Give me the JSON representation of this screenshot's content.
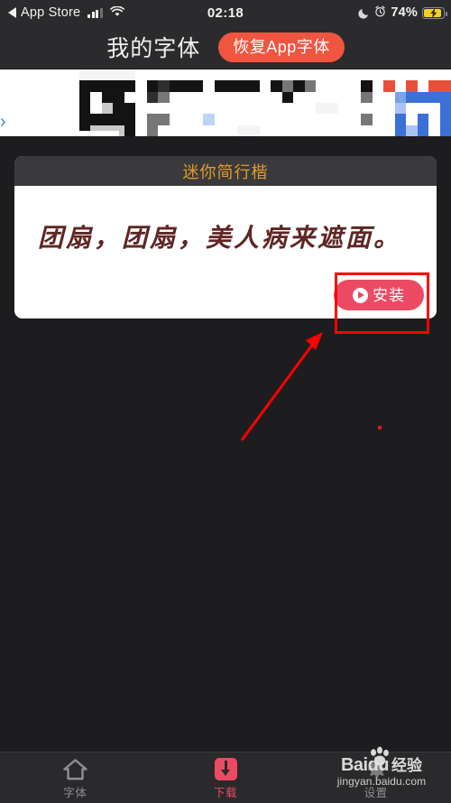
{
  "statusbar": {
    "back_label": "App Store",
    "back_icon": "back-caret-icon",
    "signal_icon": "cellular-signal-icon",
    "wifi_icon": "wifi-icon",
    "time": "02:18",
    "moon_icon": "moon-do-not-disturb-icon",
    "alarm_icon": "alarm-clock-icon",
    "battery_percent": "74%",
    "battery_icon": "battery-charging-icon",
    "battery_fill_color": "#f5d020"
  },
  "navbar": {
    "title": "我的字体",
    "restore_button": "恢复App字体",
    "restore_button_color": "#f05540"
  },
  "banner": {
    "name": "pixelated-ad-banner",
    "chevron": "›",
    "chevron_color": "#3f7fd0",
    "accent_red": "#e8503a",
    "accent_blue": "#3b70d6"
  },
  "card": {
    "title": "迷你简行楷",
    "title_color": "#e39b2a",
    "header_bg": "#3a3a3c",
    "preview_text": "团扇，团扇，美人病来遮面。",
    "preview_color": "#5e2624",
    "install_button": "安装",
    "install_icon": "play-circle-icon",
    "install_color": "#ec4a63"
  },
  "annotations": {
    "highlight_box": "install-button-highlight",
    "arrow": "pointer-arrow",
    "color": "#ff0000"
  },
  "tabbar": {
    "items": [
      {
        "label": "字体",
        "icon": "home-icon",
        "active": false
      },
      {
        "label": "下载",
        "icon": "download-icon",
        "active": true
      },
      {
        "label": "设置",
        "icon": "gear-icon",
        "active": false
      }
    ],
    "active_color": "#ec4a63",
    "inactive_color": "#8d8d8f"
  },
  "watermark": {
    "brand": "Bai",
    "brand_suffix": "du",
    "jingyan": "经验",
    "url": "jingyan.baidu.com",
    "paw_icon": "paw-print-icon"
  }
}
